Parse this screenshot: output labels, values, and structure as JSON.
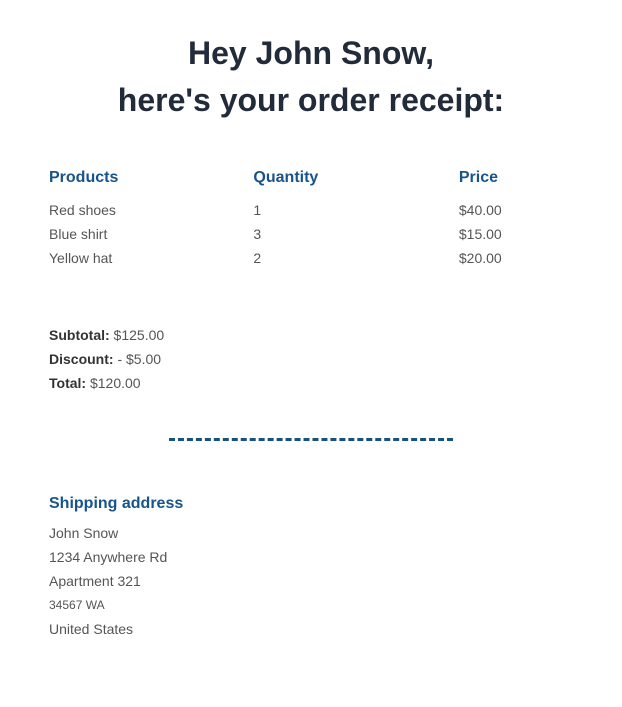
{
  "colors": {
    "heading": "#222b3a",
    "accent_blue": "#18548c",
    "body_text": "#555555",
    "label_text": "#333333",
    "divider": "#17527e",
    "background": "#ffffff"
  },
  "heading": {
    "line1": "Hey John Snow,",
    "line2": "here's your order receipt:"
  },
  "order_table": {
    "columns": [
      "Products",
      "Quantity",
      "Price"
    ],
    "rows": [
      {
        "product": "Red shoes",
        "quantity": "1",
        "price": "$40.00"
      },
      {
        "product": "Blue shirt",
        "quantity": "3",
        "price": "$15.00"
      },
      {
        "product": "Yellow hat",
        "quantity": "2",
        "price": "$20.00"
      }
    ]
  },
  "totals": [
    {
      "label": "Subtotal:",
      "value": " $125.00"
    },
    {
      "label": "Discount:",
      "value": " - $5.00"
    },
    {
      "label": "Total:",
      "value": " $120.00"
    }
  ],
  "shipping": {
    "title": "Shipping address",
    "lines": [
      {
        "text": "John Snow",
        "small": false
      },
      {
        "text": "1234 Anywhere Rd",
        "small": false
      },
      {
        "text": "Apartment 321",
        "small": false
      },
      {
        "text": "34567 WA",
        "small": true
      },
      {
        "text": "United States",
        "small": false
      }
    ]
  }
}
